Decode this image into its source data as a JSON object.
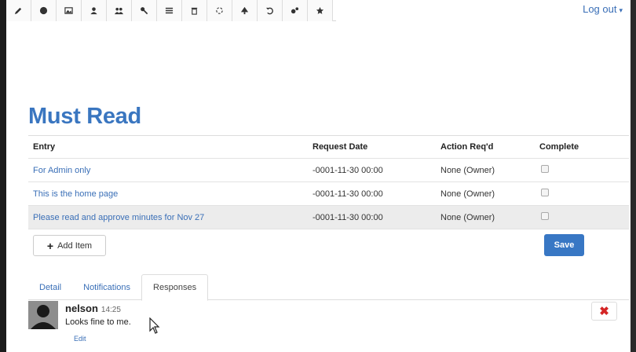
{
  "header": {
    "logout_label": "Log out",
    "caret": "▾"
  },
  "toolbar": {
    "icons": [
      "pencil-icon",
      "dot-circle-icon",
      "image-icon",
      "user-icon",
      "users-icon",
      "key-icon",
      "list-icon",
      "trash-icon",
      "spinner-icon",
      "tree-icon",
      "undo-icon",
      "cogs-icon",
      "star-icon"
    ]
  },
  "page": {
    "title": "Must Read"
  },
  "table": {
    "headers": [
      "Entry",
      "Request Date",
      "Action Req'd",
      "Complete"
    ],
    "rows": [
      {
        "entry": "For Admin only",
        "date": "-0001-11-30 00:00",
        "action": "None (Owner)"
      },
      {
        "entry": "This is the home page",
        "date": "-0001-11-30 00:00",
        "action": "None (Owner)"
      },
      {
        "entry": "Please read and approve minutes for Nov 27",
        "date": "-0001-11-30 00:00",
        "action": "None (Owner)"
      }
    ]
  },
  "buttons": {
    "add_item": "Add Item",
    "add_plus": "+",
    "save": "Save",
    "delete": "✖"
  },
  "tabs": [
    {
      "label": "Detail"
    },
    {
      "label": "Notifications"
    },
    {
      "label": "Responses"
    }
  ],
  "response": {
    "user": "nelson",
    "time": "14:25",
    "message": "Looks fine to me.",
    "edit_label": "Edit"
  }
}
